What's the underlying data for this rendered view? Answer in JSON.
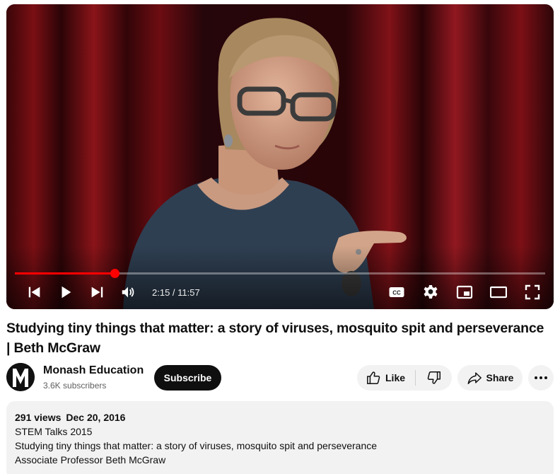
{
  "player": {
    "current_time": "2:15",
    "duration": "11:57",
    "time_display": "2:15 / 11:57",
    "progress_fraction": 0.188,
    "accent_color": "#ff0000"
  },
  "icons": {
    "previous": "skip-previous-icon",
    "play": "play-icon",
    "next": "skip-next-icon",
    "volume": "volume-icon",
    "captions": "closed-captions-icon",
    "settings": "gear-icon",
    "miniplayer": "miniplayer-icon",
    "theater": "theater-mode-icon",
    "fullscreen": "fullscreen-icon",
    "like": "thumbs-up-icon",
    "dislike": "thumbs-down-icon",
    "share": "share-arrow-icon",
    "more": "more-horizontal-icon"
  },
  "video": {
    "title": "Studying tiny things that matter: a story of viruses, mosquito spit and perseverance | Beth McGraw"
  },
  "channel": {
    "name": "Monash Education",
    "subscribers": "3.6K subscribers",
    "subscribe_label": "Subscribe"
  },
  "actions": {
    "like_label": "Like",
    "share_label": "Share"
  },
  "description": {
    "views": "291 views",
    "date": "Dec 20, 2016",
    "lines": [
      "STEM Talks 2015",
      "Studying tiny things that matter: a story of viruses, mosquito spit and perseverance",
      "Associate Professor Beth McGraw"
    ]
  }
}
